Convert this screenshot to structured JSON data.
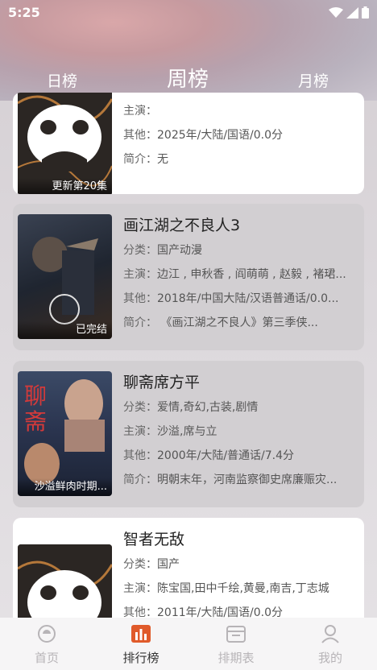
{
  "status": {
    "time": "5:25"
  },
  "tabs": {
    "day": "日榜",
    "week": "周榜",
    "month": "月榜"
  },
  "labels": {
    "category": "分类：",
    "cast": "主演：",
    "other": "其他：",
    "intro": "简介："
  },
  "items": [
    {
      "title": "",
      "category": "",
      "cast": "",
      "other": "2025年/大陆/国语/0.0分",
      "intro": "无",
      "badge": "更新第20集"
    },
    {
      "title": "画江湖之不良人3",
      "category": "国产动漫",
      "cast": "边江 , 申秋香 , 阎萌萌 , 赵毅 , 褚珺...",
      "other": "2018年/中国大陆/汉语普通话/0.0...",
      "intro": "        《画江湖之不良人》第三季侠...",
      "badge": "已完结"
    },
    {
      "title": "聊斋席方平",
      "category": "爱情,奇幻,古装,剧情",
      "cast": "沙溢,席与立",
      "other": "2000年/大陆/普通话/7.4分",
      "intro": "明朝末年，河南监察御史席廉赈灾...",
      "badge": "沙溢鲜肉时期..."
    },
    {
      "title": "智者无敌",
      "category": "国产",
      "cast": "陈宝国,田中千绘,黄曼,南吉,丁志城",
      "other": "2011年/大陆/国语/0.0分",
      "intro": "",
      "badge": ""
    }
  ],
  "nav": {
    "home": "首页",
    "rank": "排行榜",
    "schedule": "排期表",
    "mine": "我的"
  },
  "colors": {
    "accent": "#e05a2a",
    "inactive": "#b7b4b7"
  }
}
